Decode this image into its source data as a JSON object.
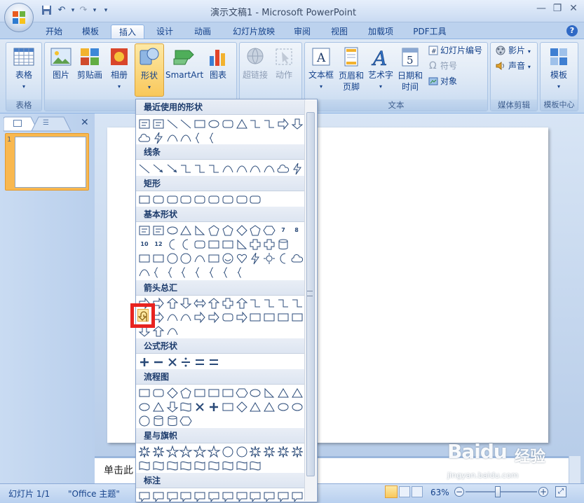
{
  "window": {
    "title": "演示文稿1 - Microsoft PowerPoint",
    "controls": [
      "—",
      "❐",
      "✕"
    ]
  },
  "quick_access": {
    "icons": [
      "save-icon",
      "undo-icon",
      "redo-icon",
      "customize-icon"
    ]
  },
  "tabs": [
    {
      "label": "开始"
    },
    {
      "label": "模板"
    },
    {
      "label": "插入",
      "active": true
    },
    {
      "label": "设计"
    },
    {
      "label": "动画"
    },
    {
      "label": "幻灯片放映"
    },
    {
      "label": "审阅"
    },
    {
      "label": "视图"
    },
    {
      "label": "加载项"
    },
    {
      "label": "PDF工具"
    }
  ],
  "help": "?",
  "ribbon": {
    "groups": [
      {
        "label": "表格",
        "buttons": [
          {
            "label": "表格"
          }
        ]
      },
      {
        "label": "插",
        "buttons": [
          {
            "label": "图片"
          },
          {
            "label": "剪贴画"
          },
          {
            "label": "相册"
          },
          {
            "label": "形状"
          },
          {
            "label": "SmartArt"
          },
          {
            "label": "图表"
          }
        ]
      },
      {
        "label": "",
        "buttons": [
          {
            "label": "超链接"
          },
          {
            "label": "动作"
          }
        ]
      },
      {
        "label": "文本",
        "buttons": [
          {
            "label": "文本框"
          },
          {
            "label": "页眉和页脚"
          },
          {
            "label": "艺术字"
          },
          {
            "label": "日期和时间"
          },
          {
            "label": "幻灯片编号"
          },
          {
            "label": "符号"
          },
          {
            "label": "对象"
          }
        ]
      },
      {
        "label": "媒体剪辑",
        "buttons": [
          {
            "label": "影片"
          },
          {
            "label": "声音"
          }
        ]
      },
      {
        "label": "模板中心",
        "buttons": [
          {
            "label": "模板"
          }
        ]
      }
    ],
    "date_icon_number": "5"
  },
  "shapes_gallery": {
    "sections": [
      {
        "title": "最近使用的形状"
      },
      {
        "title": "线条"
      },
      {
        "title": "矩形"
      },
      {
        "title": "基本形状"
      },
      {
        "title": "箭头总汇"
      },
      {
        "title": "公式形状"
      },
      {
        "title": "流程图"
      },
      {
        "title": "星与旗帜"
      },
      {
        "title": "标注"
      }
    ],
    "basic_number_badges": [
      "7",
      "8",
      "10",
      "12"
    ]
  },
  "notes": {
    "text": "单击此"
  },
  "status": {
    "slide": "幻灯片 1/1",
    "theme": "\"Office 主题\"",
    "zoom": "63%"
  },
  "watermark": {
    "brand": "Baidu",
    "label": "经验",
    "site": "jingyan.baidu.com"
  },
  "colors": {
    "accent": "#15428b",
    "highlight": "#e8231f"
  }
}
